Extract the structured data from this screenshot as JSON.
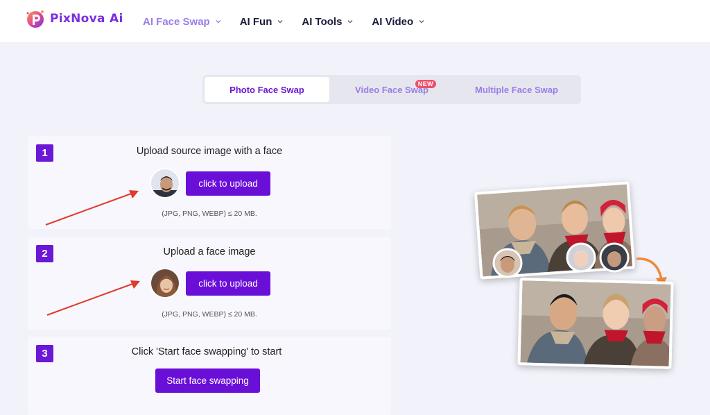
{
  "brand": {
    "name": "PixNova Ai"
  },
  "nav": [
    {
      "label": "AI Face Swap",
      "active": true
    },
    {
      "label": "AI Fun",
      "active": false
    },
    {
      "label": "AI Tools",
      "active": false
    },
    {
      "label": "AI Video",
      "active": false
    }
  ],
  "tabs": [
    {
      "label": "Photo Face Swap",
      "active": true
    },
    {
      "label": "Video Face Swap",
      "active": false,
      "badge": "NEW"
    },
    {
      "label": "Multiple Face Swap",
      "active": false
    }
  ],
  "steps": [
    {
      "number": "1",
      "title": "Upload source image with a face",
      "button": "click to upload",
      "hint": "(JPG, PNG, WEBP) ≤ 20 MB."
    },
    {
      "number": "2",
      "title": "Upload a face image",
      "button": "click to upload",
      "hint": "(JPG, PNG, WEBP) ≤ 20 MB."
    },
    {
      "number": "3",
      "title": "Click 'Start face swapping' to start",
      "button": "Start face swapping"
    }
  ],
  "colors": {
    "accent": "#6a0fd8",
    "nav_active": "#9a7de8",
    "arrow": "#e03a2a",
    "badge": "#f04f6a",
    "swap_arrow": "#f08a3a"
  }
}
